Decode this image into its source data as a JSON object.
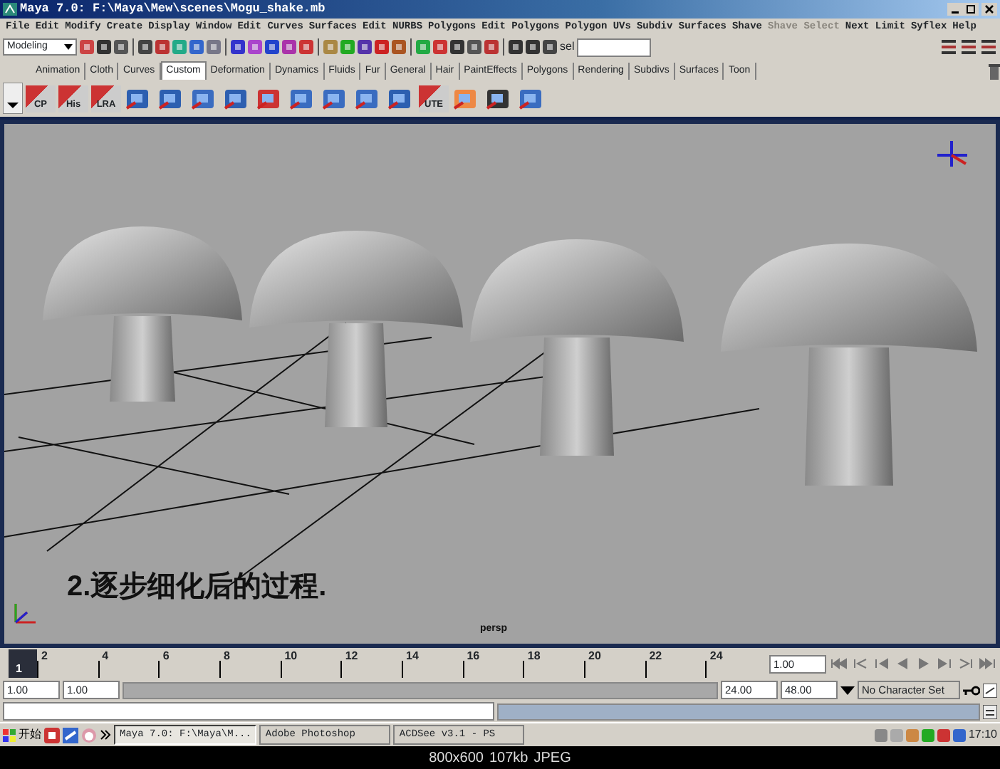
{
  "window": {
    "title": "Maya 7.0: F:\\Maya\\Mew\\scenes\\Mogu_shake.mb"
  },
  "menu": [
    {
      "label": "File",
      "disabled": false
    },
    {
      "label": "Edit",
      "disabled": false
    },
    {
      "label": "Modify",
      "disabled": false
    },
    {
      "label": "Create",
      "disabled": false
    },
    {
      "label": "Display",
      "disabled": false
    },
    {
      "label": "Window",
      "disabled": false
    },
    {
      "label": "Edit Curves",
      "disabled": false
    },
    {
      "label": "Surfaces",
      "disabled": false
    },
    {
      "label": "Edit NURBS",
      "disabled": false
    },
    {
      "label": "Polygons",
      "disabled": false
    },
    {
      "label": "Edit Polygons",
      "disabled": false
    },
    {
      "label": "Polygon UVs",
      "disabled": false
    },
    {
      "label": "Subdiv Surfaces",
      "disabled": false
    },
    {
      "label": "Shave",
      "disabled": false
    },
    {
      "label": "Shave Select",
      "disabled": true
    },
    {
      "label": "Next Limit",
      "disabled": false
    },
    {
      "label": "Syflex",
      "disabled": false
    },
    {
      "label": "Help",
      "disabled": false
    }
  ],
  "status_line": {
    "mode": "Modeling",
    "selection_label": "sel"
  },
  "shelf_tabs": [
    {
      "label": "Animation",
      "selected": false
    },
    {
      "label": "Cloth",
      "selected": false
    },
    {
      "label": "Curves",
      "selected": false
    },
    {
      "label": "Custom",
      "selected": true
    },
    {
      "label": "Deformation",
      "selected": false
    },
    {
      "label": "Dynamics",
      "selected": false
    },
    {
      "label": "Fluids",
      "selected": false
    },
    {
      "label": "Fur",
      "selected": false
    },
    {
      "label": "General",
      "selected": false
    },
    {
      "label": "Hair",
      "selected": false
    },
    {
      "label": "PaintEffects",
      "selected": false
    },
    {
      "label": "Polygons",
      "selected": false
    },
    {
      "label": "Rendering",
      "selected": false
    },
    {
      "label": "Subdivs",
      "selected": false
    },
    {
      "label": "Surfaces",
      "selected": false
    },
    {
      "label": "Toon",
      "selected": false
    }
  ],
  "shelf_buttons": [
    {
      "kind": "label",
      "label": "CP"
    },
    {
      "kind": "label",
      "label": "His"
    },
    {
      "kind": "label",
      "label": "LRA"
    },
    {
      "kind": "icon"
    },
    {
      "kind": "icon"
    },
    {
      "kind": "icon"
    },
    {
      "kind": "icon"
    },
    {
      "kind": "icon"
    },
    {
      "kind": "icon"
    },
    {
      "kind": "icon"
    },
    {
      "kind": "icon"
    },
    {
      "kind": "icon"
    },
    {
      "kind": "label",
      "label": "UTE"
    },
    {
      "kind": "icon"
    },
    {
      "kind": "icon"
    },
    {
      "kind": "icon"
    }
  ],
  "viewport": {
    "camera": "persp",
    "caption": "2.逐步细化后的过程."
  },
  "timeline": {
    "current_frame": "1",
    "ticks": [
      "2",
      "4",
      "6",
      "8",
      "10",
      "12",
      "14",
      "16",
      "18",
      "20",
      "22",
      "24"
    ],
    "current_time": "1.00"
  },
  "range": {
    "start": "1.00",
    "playback_start": "1.00",
    "playback_end": "24.00",
    "end": "48.00",
    "slider": {
      "level": 1
    },
    "character_set": "No Character Set"
  },
  "taskbar": {
    "start": "开始",
    "tasks": [
      {
        "label": "Maya 7.0: F:\\Maya\\M...",
        "selected": true
      },
      {
        "label": "Adobe Photoshop",
        "selected": false
      },
      {
        "label": "ACDSee v3.1 - PS",
        "selected": false
      }
    ],
    "clock": "17:10"
  },
  "viewer_status": [
    "800x600",
    "107kb",
    "JPEG"
  ]
}
